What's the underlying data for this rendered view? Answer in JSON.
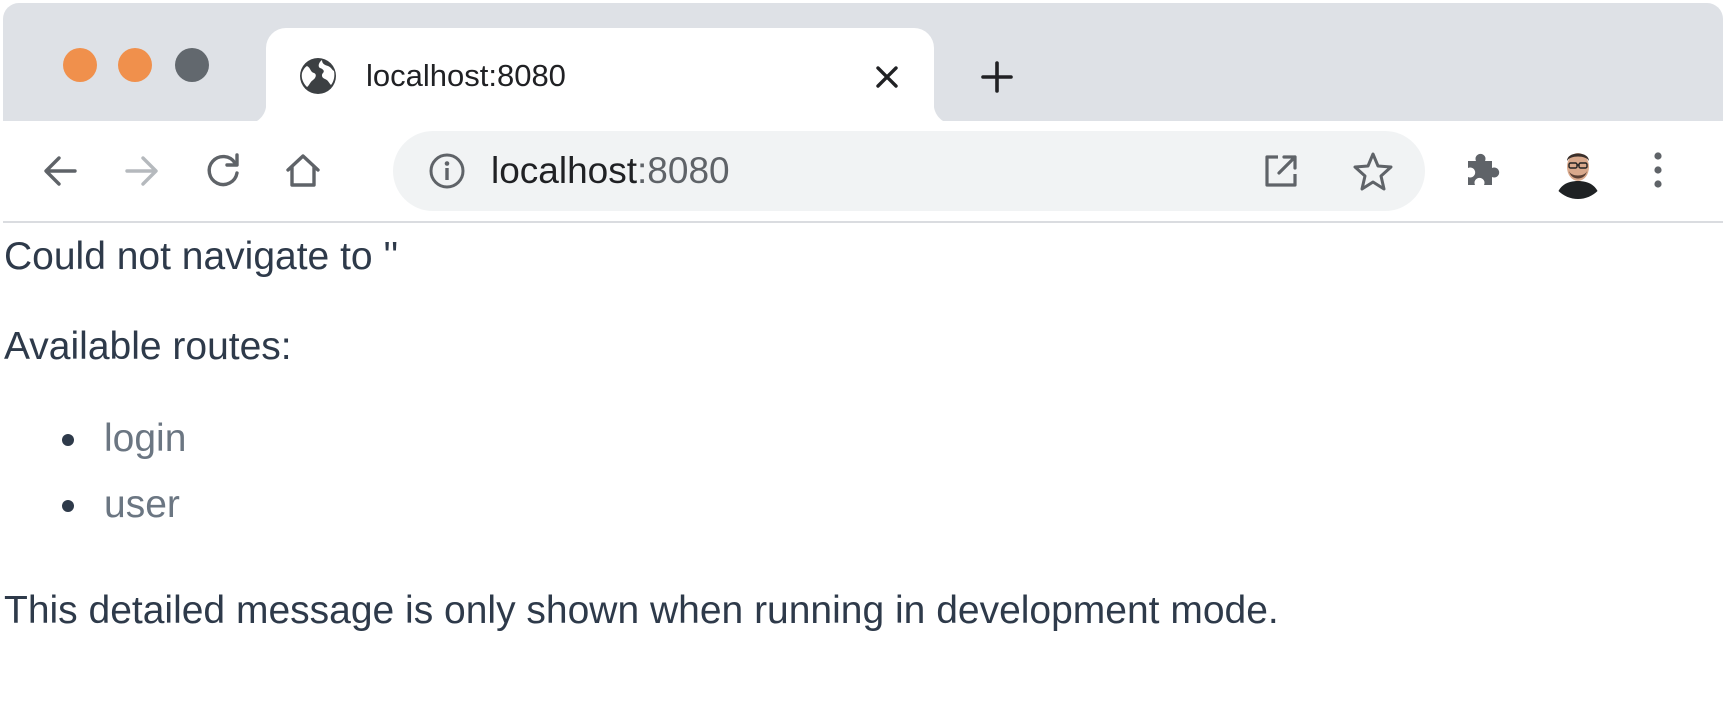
{
  "window": {
    "traffic_lights": {
      "close": "#f0904c",
      "minimize": "#f0904c",
      "maximize": "#62686e"
    }
  },
  "tab": {
    "title": "localhost:8080",
    "favicon": "globe-icon"
  },
  "toolbar": {
    "back": "arrow-left-icon",
    "forward": "arrow-right-icon",
    "reload": "reload-icon",
    "home": "home-icon",
    "address": {
      "host": "localhost",
      "port": ":8080"
    },
    "extensions": "puzzle-icon",
    "menu": "more-vertical-icon"
  },
  "page": {
    "error": "Could not navigate to ''",
    "available_label": "Available routes:",
    "routes": [
      {
        "label": "login"
      },
      {
        "label": "user"
      }
    ],
    "footer": "This detailed message is only shown when running in development mode."
  },
  "colors": {
    "tabstrip": "#dee1e6",
    "omnibox": "#f1f3f4",
    "text": "#2e3a4a",
    "link": "#6b7682"
  }
}
